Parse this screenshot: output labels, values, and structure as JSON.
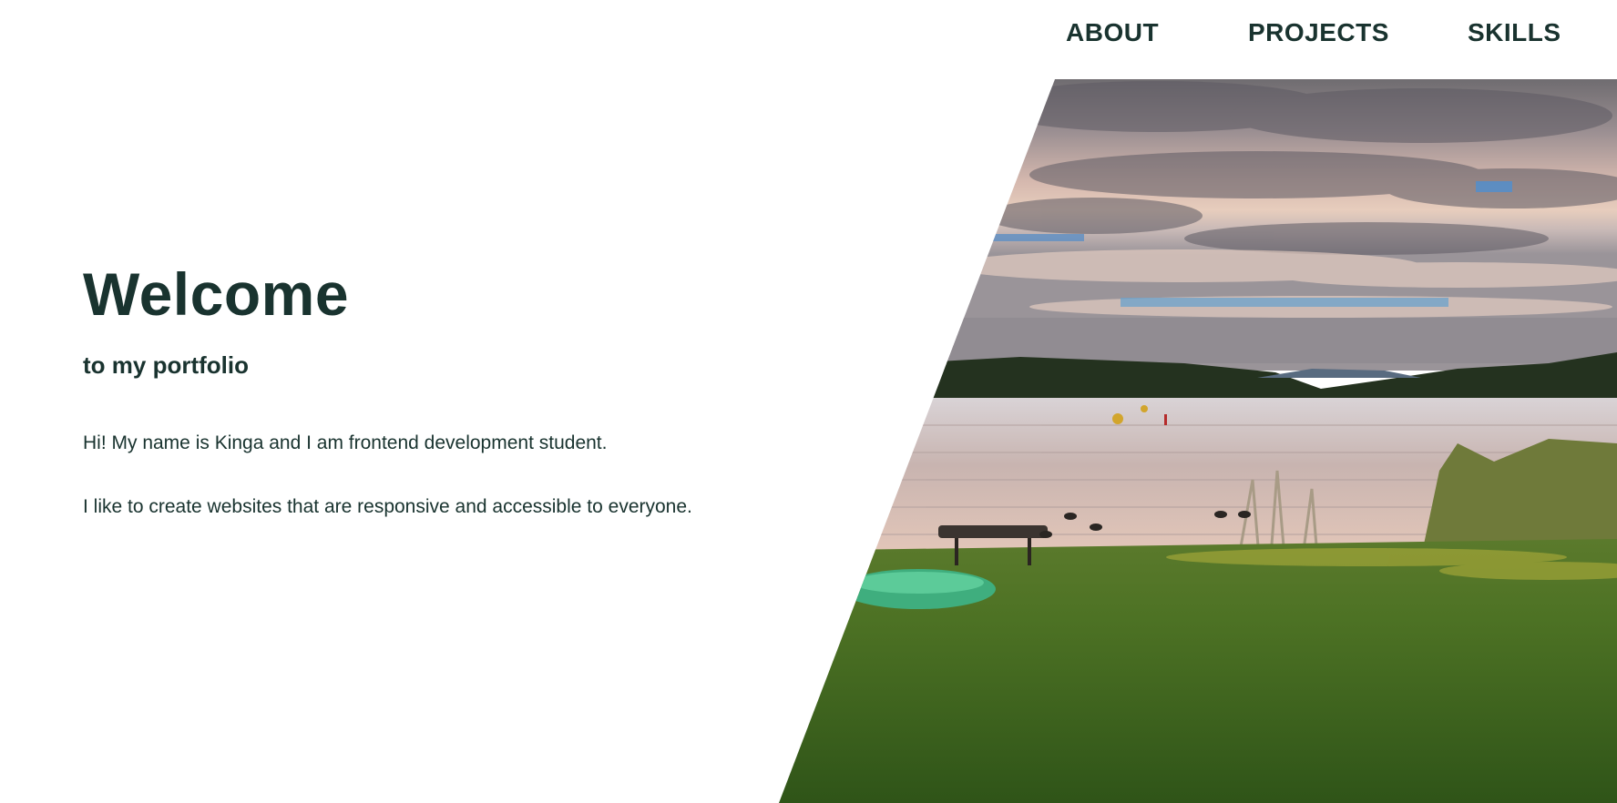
{
  "nav": {
    "items": [
      {
        "label": "ABOUT"
      },
      {
        "label": "PROJECTS"
      },
      {
        "label": "SKILLS"
      }
    ]
  },
  "hero": {
    "title": "Welcome",
    "subtitle": "to my portfolio",
    "paragraphs": [
      "Hi! My name is Kinga and I am frontend development student.",
      "I like to create websites that are responsive and accessible to everyone."
    ],
    "image": "lake-landscape-photo"
  },
  "colors": {
    "text": "#19332f",
    "background": "#ffffff",
    "grass": "#3f6b22",
    "water": "#c9b5ad",
    "sky": "#d6c2b4"
  }
}
